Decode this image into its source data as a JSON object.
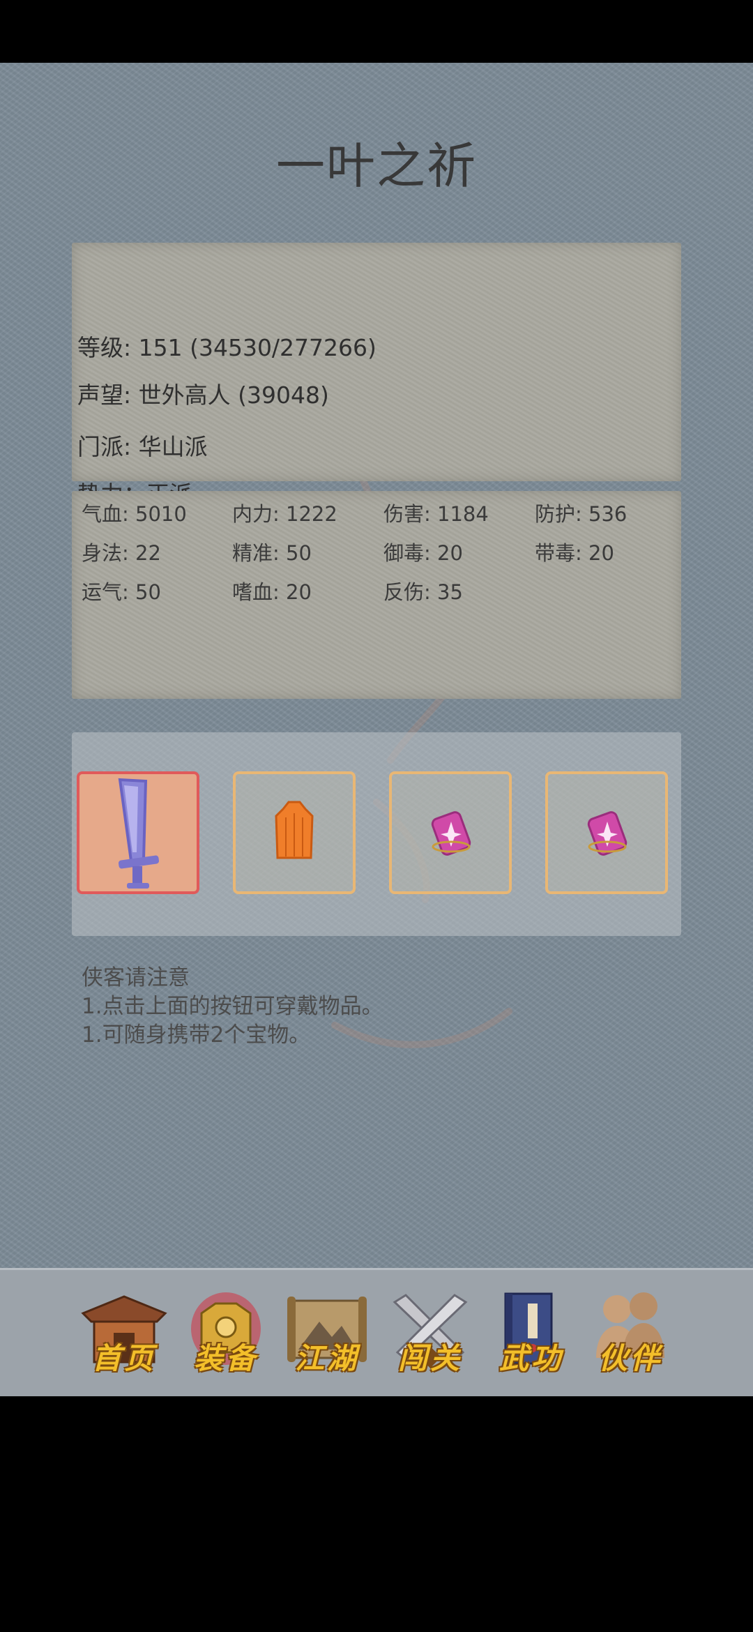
{
  "title": "一叶之祈",
  "info": {
    "level": "等级: 151 (34530/277266)",
    "reputation": "声望: 世外高人 (39048)",
    "sect": "门派: 华山派",
    "faction": "势力：正派"
  },
  "stats": [
    {
      "label": "气血: 5010"
    },
    {
      "label": "内力: 1222"
    },
    {
      "label": "伤害: 1184"
    },
    {
      "label": "防护: 536"
    },
    {
      "label": "身法: 22"
    },
    {
      "label": "精准: 50"
    },
    {
      "label": "御毒: 20"
    },
    {
      "label": "带毒: 20"
    },
    {
      "label": "运气: 50"
    },
    {
      "label": "嗜血: 20"
    },
    {
      "label": "反伤: 35"
    }
  ],
  "equipment": [
    {
      "icon": "sword-icon",
      "selected": true
    },
    {
      "icon": "armor-icon",
      "selected": false
    },
    {
      "icon": "treasure-icon",
      "selected": false
    },
    {
      "icon": "treasure-icon",
      "selected": false
    }
  ],
  "notes": {
    "heading": "侠客请注意",
    "line1": "1.点击上面的按钮可穿戴物品。",
    "line2": "1.可随身携带2个宝物。"
  },
  "nav": [
    {
      "label": "首页",
      "icon": "house-icon"
    },
    {
      "label": "装备",
      "icon": "armor-icon",
      "active": true
    },
    {
      "label": "江湖",
      "icon": "scroll-icon"
    },
    {
      "label": "闯关",
      "icon": "crossed-swords-icon"
    },
    {
      "label": "武功",
      "icon": "book-icon"
    },
    {
      "label": "伙伴",
      "icon": "companions-icon"
    }
  ]
}
